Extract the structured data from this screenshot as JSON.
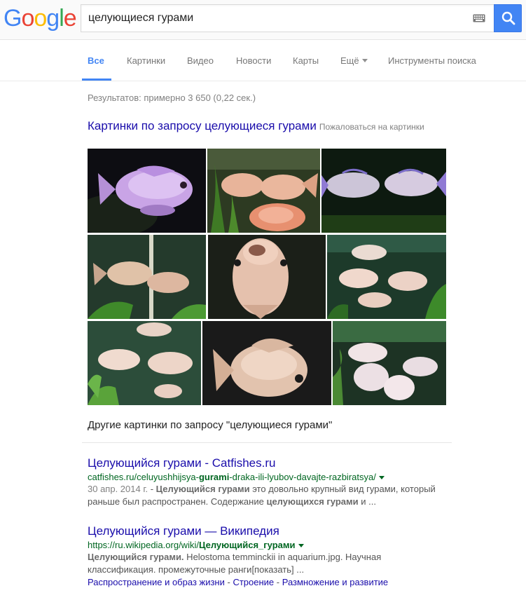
{
  "logo": {
    "text": "Google",
    "letters": [
      "G",
      "o",
      "o",
      "g",
      "l",
      "e"
    ]
  },
  "search": {
    "value": "целующиеся гурами"
  },
  "tabs": [
    {
      "label": "Все"
    },
    {
      "label": "Картинки"
    },
    {
      "label": "Видео"
    },
    {
      "label": "Новости"
    },
    {
      "label": "Карты"
    },
    {
      "label": "Ещё"
    },
    {
      "label": "Инструменты поиска"
    }
  ],
  "stats": "Результатов: примерно 3 650 (0,22 сек.)",
  "images_block": {
    "heading": "Картинки по запросу целующиеся гурами",
    "report": "Пожаловаться на картинки",
    "more": "Другие картинки по запросу \"целующиеся гурами\""
  },
  "results": [
    {
      "title": "Целующийся гурами - Catfishes.ru",
      "url_pre": "catfishes.ru/celuyushhijsya-",
      "url_bold": "gurami",
      "url_post": "-draka-ili-lyubov-davajte-razbiratsya/",
      "date": "30 апр. 2014 г.",
      "snippet": [
        {
          "t": " - ",
          "b": false
        },
        {
          "t": "Целующийся гурами",
          "b": true
        },
        {
          "t": " это довольно крупный вид гурами, который раньше был распространен. Содержание ",
          "b": false
        },
        {
          "t": "целующихся гурами",
          "b": true
        },
        {
          "t": " и ...",
          "b": false
        }
      ]
    },
    {
      "title": "Целующийся гурами — Википедия",
      "url_pre": "https://ru.wikipedia.org/wiki/",
      "url_bold": "Целующийся_гурами",
      "url_post": "",
      "snippet": [
        {
          "t": "Целующийся гурами.",
          "b": true
        },
        {
          "t": " Helostoma temminckii in aquarium.jpg. Научная классификация. промежуточные ранги[показать] ...",
          "b": false
        }
      ],
      "links": [
        "Распространение и образ жизни",
        "Строение",
        "Размножение и развитие"
      ]
    }
  ],
  "colors": {
    "blue": "#4285f4",
    "link": "#1a0dab",
    "url_green": "#006621",
    "snippet": "#545454"
  }
}
